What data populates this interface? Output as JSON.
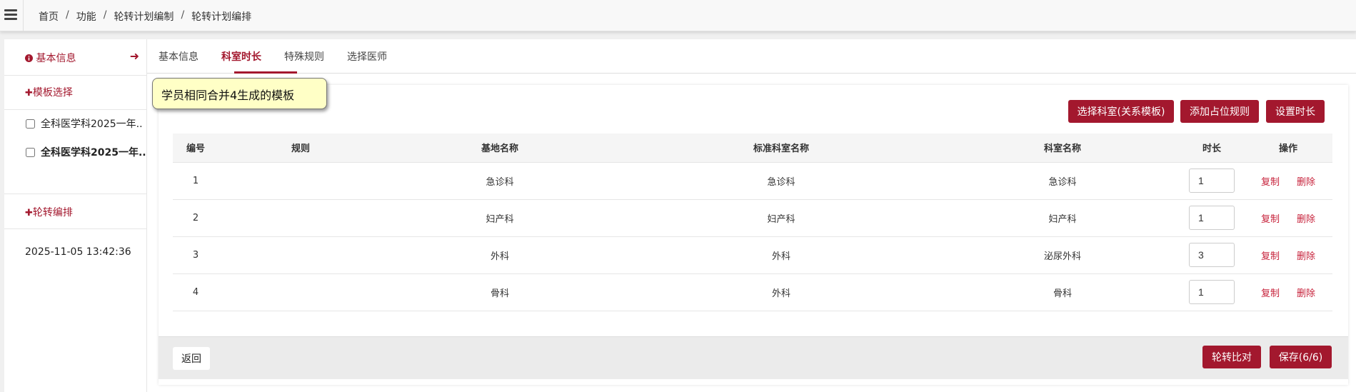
{
  "breadcrumb": [
    "首页",
    "功能",
    "轮转计划编制",
    "轮转计划编排"
  ],
  "sidebar": {
    "basic_info": "基本信息",
    "template_select": "模板选择",
    "templates": [
      {
        "label": "全科医学科2025一年...",
        "checked": false,
        "bold": false
      },
      {
        "label": "全科医学科2025一年...",
        "checked": false,
        "bold": true
      }
    ],
    "rotation_schedule": "轮转编排",
    "timestamp": "2025-11-05 13:42:36"
  },
  "tabs": [
    "基本信息",
    "科室时长",
    "特殊规则",
    "选择医师"
  ],
  "active_tab": "科室时长",
  "tooltip": "学员相同合并4生成的模板",
  "actions": {
    "select_dept": "选择科室(关系模板)",
    "add_rule": "添加占位规则",
    "set_duration": "设置时长"
  },
  "table": {
    "headers": [
      "编号",
      "规则",
      "基地名称",
      "标准科室名称",
      "科室名称",
      "时长",
      "操作"
    ],
    "rows": [
      {
        "no": "1",
        "rule": "",
        "base": "急诊科",
        "std": "急诊科",
        "dept": "急诊科",
        "duration": "1"
      },
      {
        "no": "2",
        "rule": "",
        "base": "妇产科",
        "std": "妇产科",
        "dept": "妇产科",
        "duration": "1"
      },
      {
        "no": "3",
        "rule": "",
        "base": "外科",
        "std": "外科",
        "dept": "泌尿外科",
        "duration": "3"
      },
      {
        "no": "4",
        "rule": "",
        "base": "骨科",
        "std": "外科",
        "dept": "骨科",
        "duration": "1"
      }
    ],
    "op_copy": "复制",
    "op_delete": "删除"
  },
  "footer": {
    "back": "返回",
    "compare": "轮转比对",
    "save": "保存(6/6)"
  },
  "colors": {
    "accent": "#a3182e",
    "link": "#c7223b"
  }
}
